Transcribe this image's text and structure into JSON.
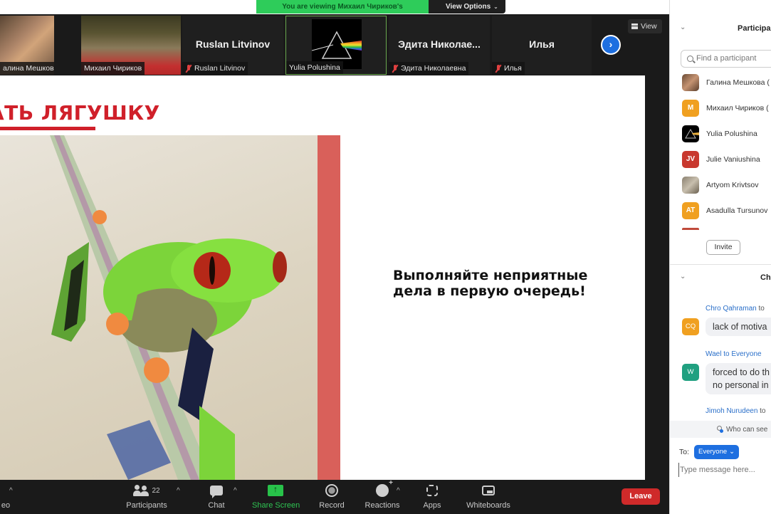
{
  "banner": {
    "viewing_text": "You are viewing Михаил Чириков's screen",
    "view_options_label": "View Options"
  },
  "video_strip": {
    "tiles": [
      {
        "name": "Галина Мешкова",
        "display_label": "алина Мешкова",
        "muted": false,
        "type": "video"
      },
      {
        "name": "Михаил Чириков",
        "display_label": "Михаил Чириков",
        "muted": false,
        "type": "video"
      },
      {
        "name": "Ruslan Litvinov",
        "display_label": "Ruslan Litvinov",
        "big_name": "Ruslan Litvinov",
        "muted": true,
        "type": "name"
      },
      {
        "name": "Yulia Polushina",
        "display_label": "Yulia Polushina",
        "muted": false,
        "type": "image",
        "active_speaker": true
      },
      {
        "name": "Эдита Николаевна",
        "display_label": "Эдита Николаевна",
        "big_name": "Эдита  Николае...",
        "muted": true,
        "type": "name"
      },
      {
        "name": "Илья",
        "display_label": "Илья",
        "big_name": "Илья",
        "muted": true,
        "type": "name"
      }
    ],
    "next_page_icon": "chevron-right-icon",
    "view_button_label": "View"
  },
  "slide": {
    "title": "ать лягушку",
    "body_line1": "Выполняйте неприятные",
    "body_line2": "дела в первую очередь!",
    "accent_color": "#d0202a",
    "bar_color": "#d9605a",
    "image_subject": "red-eyed tree frog illustration"
  },
  "toolbar": {
    "video_label": "eo",
    "participants_label": "Participants",
    "participants_count": "22",
    "chat_label": "Chat",
    "share_screen_label": "Share Screen",
    "record_label": "Record",
    "reactions_label": "Reactions",
    "apps_label": "Apps",
    "whiteboards_label": "Whiteboards",
    "leave_label": "Leave",
    "share_color": "#28c24a",
    "leave_color": "#cf2a2a"
  },
  "participants_panel": {
    "title": "Participa",
    "search_placeholder": "Find a participant",
    "items": [
      {
        "name": "Галина Мешкова (",
        "avatar": "photo"
      },
      {
        "name": "Михаил Чириков (",
        "avatar_initials": "M",
        "avatar_color": "#f0a020"
      },
      {
        "name": "Yulia Polushina",
        "avatar": "prism-image"
      },
      {
        "name": "Julie Vaniushina",
        "avatar_initials": "JV",
        "avatar_color": "#c8382e"
      },
      {
        "name": "Artyom Krivtsov",
        "avatar": "photo"
      },
      {
        "name": "Asadulla Tursunov",
        "avatar_initials": "AT",
        "avatar_color": "#f0a020"
      }
    ],
    "invite_label": "Invite"
  },
  "chat_panel": {
    "title": "Ch",
    "messages": [
      {
        "sender": "Chro Qahraman",
        "to": " to",
        "initials": "CQ",
        "avatar_color": "#f0a020",
        "lines": [
          "lack of motiva"
        ]
      },
      {
        "sender": "Wael",
        "to": " to Everyone",
        "initials": "W",
        "avatar_color": "#20a080",
        "lines": [
          "forced to do th",
          "no personal in"
        ]
      },
      {
        "sender": "Jimoh Nurudeen",
        "to": " to",
        "lines": []
      }
    ],
    "who_can_see_label": "Who can see",
    "to_label": "To:",
    "recipient": "Everyone",
    "input_placeholder": "Type message here..."
  }
}
